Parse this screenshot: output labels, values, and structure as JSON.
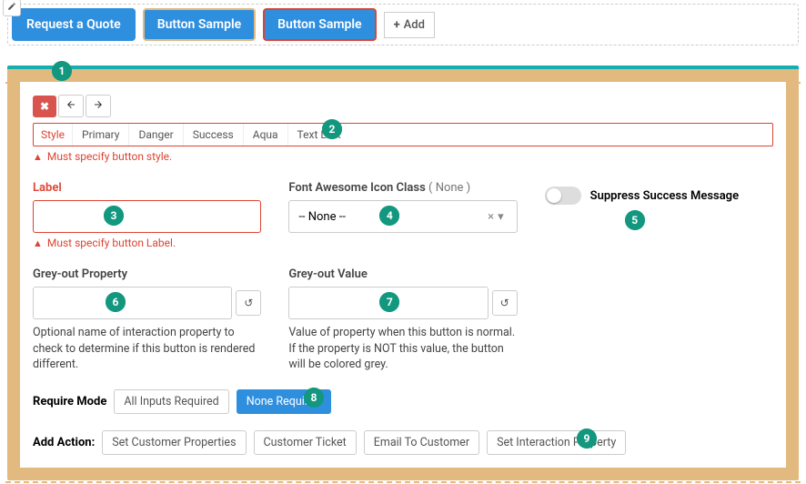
{
  "topbar": {
    "buttons": [
      {
        "label": "Request a Quote"
      },
      {
        "label": "Button Sample"
      },
      {
        "label": "Button Sample"
      }
    ],
    "add_label": "Add"
  },
  "toolbar": {
    "close": "✖",
    "back": "←",
    "forward": "→"
  },
  "style": {
    "label": "Style",
    "options": [
      "Primary",
      "Danger",
      "Success",
      "Aqua",
      "Text Link"
    ],
    "error": "Must specify button style."
  },
  "labelField": {
    "label": "Label",
    "value": "",
    "error": "Must specify button Label."
  },
  "iconField": {
    "label": "Font Awesome Icon Class",
    "sub": "( None )",
    "selected": "-- None --"
  },
  "suppress": {
    "label": "Suppress Success Message"
  },
  "greyProp": {
    "label": "Grey-out Property",
    "help": "Optional name of interaction property to check to determine if this button is rendered different."
  },
  "greyVal": {
    "label": "Grey-out Value",
    "help": "Value of property when this button is normal. If the property is NOT this value, the button will be colored grey."
  },
  "requireMode": {
    "label": "Require Mode",
    "options": [
      "All Inputs Required",
      "None Required"
    ],
    "selected": "None Required"
  },
  "addAction": {
    "label": "Add Action:",
    "options": [
      "Set Customer Properties",
      "Customer Ticket",
      "Email To Customer",
      "Set Interaction Property"
    ]
  },
  "callouts": [
    "1",
    "2",
    "3",
    "4",
    "5",
    "6",
    "7",
    "8",
    "9"
  ]
}
